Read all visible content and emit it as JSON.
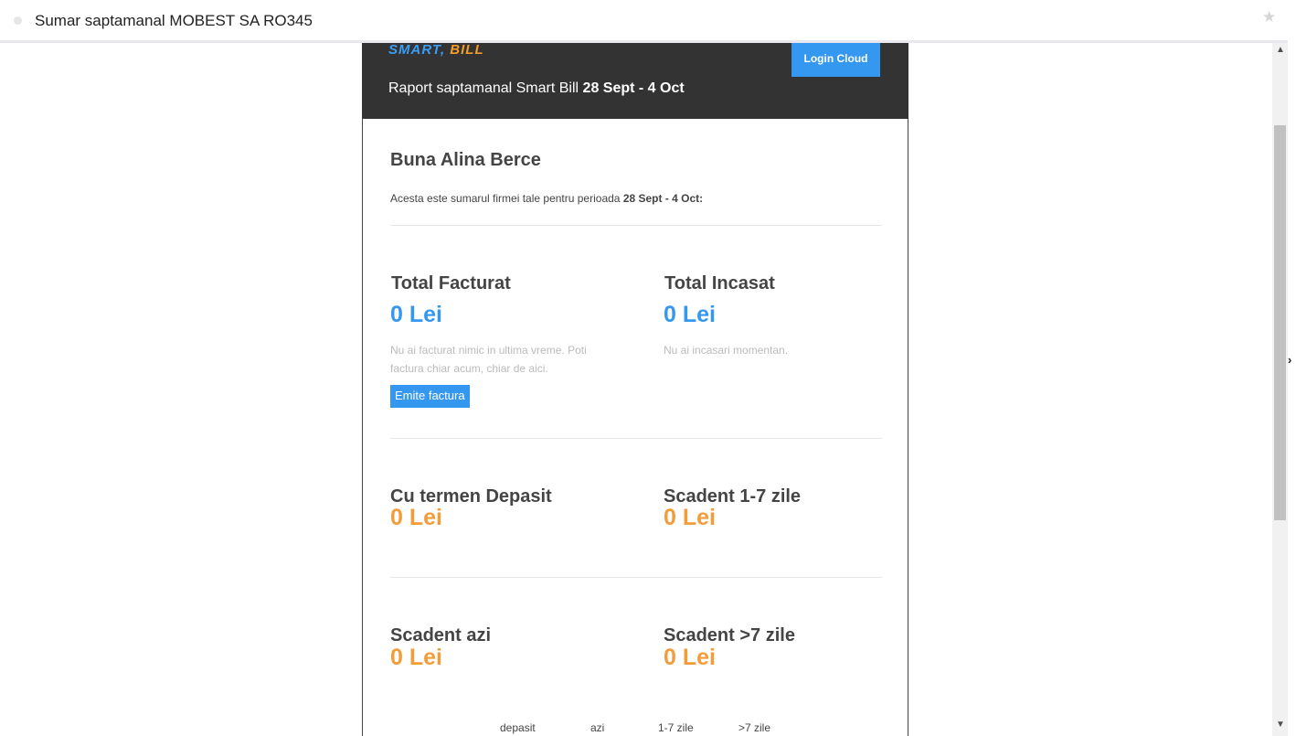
{
  "window": {
    "title": "Sumar saptamanal MOBEST SA RO345"
  },
  "header": {
    "logo_smart": "SMART,",
    "logo_bill": "BILL",
    "login_label": "Login Cloud",
    "report_prefix": "Raport saptamanal Smart Bill",
    "report_period": "28 Sept - 4 Oct"
  },
  "content": {
    "greeting": "Buna Alina Berce",
    "intro_prefix": "Acesta este sumarul firmei tale pentru perioada",
    "intro_period": "28 Sept - 4 Oct:",
    "total_facturat": {
      "title": "Total Facturat",
      "value": "0 Lei",
      "note": "Nu ai facturat nimic in ultima vreme. Poti factura chiar acum, chiar de aici.",
      "button": "Emite factura"
    },
    "total_incasat": {
      "title": "Total Incasat",
      "value": "0 Lei",
      "note": "Nu ai incasari momentan."
    },
    "termen_depasit": {
      "title": "Cu termen Depasit",
      "value": "0 Lei"
    },
    "scadent_1_7": {
      "title": "Scadent 1-7 zile",
      "value": "0 Lei"
    },
    "scadent_azi": {
      "title": "Scadent azi",
      "value": "0 Lei"
    },
    "scadent_7plus": {
      "title": "Scadent >7 zile",
      "value": "0 Lei"
    },
    "legend": [
      "depasit",
      "azi",
      "1-7 zile",
      ">7 zile"
    ]
  },
  "colors": {
    "accent_blue": "#3497f0",
    "accent_orange": "#f39c3a",
    "header_bg": "#333333"
  },
  "icons": {
    "star": "star-icon",
    "scroll_up": "chevron-up-icon",
    "scroll_down": "chevron-down-icon",
    "side_toggle": "chevron-right-icon"
  }
}
